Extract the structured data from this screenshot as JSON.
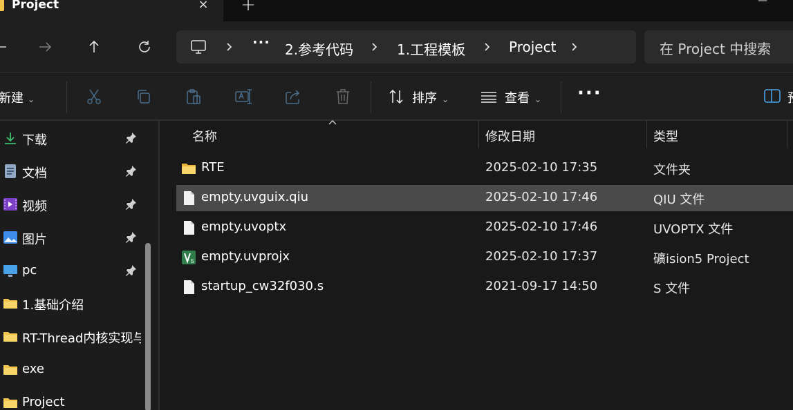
{
  "tab": {
    "title": "Project",
    "close": "×",
    "new": "+"
  },
  "nav": {
    "back": "←",
    "forward": "→",
    "up": "↑",
    "refresh": "↻",
    "more": "···",
    "breadcrumbs": [
      "2.参考代码",
      "1.工程模板",
      "Project"
    ],
    "search_placeholder": "在 Project 中搜索"
  },
  "toolbar": {
    "new_label": "新建",
    "sort_label": "排序",
    "view_label": "查看",
    "more": "···",
    "details_label": "预"
  },
  "sidebar": {
    "items": [
      {
        "label": "下载",
        "icon": "download-icon",
        "pinned": true
      },
      {
        "label": "文档",
        "icon": "document-icon",
        "pinned": true
      },
      {
        "label": "视频",
        "icon": "video-icon",
        "pinned": true
      },
      {
        "label": "图片",
        "icon": "picture-icon",
        "pinned": true
      },
      {
        "label": "pc",
        "icon": "monitor-icon",
        "pinned": true
      },
      {
        "label": "1.基础介绍",
        "icon": "folder-icon",
        "pinned": false
      },
      {
        "label": "RT-Thread内核实现与",
        "icon": "folder-icon",
        "pinned": false
      },
      {
        "label": "exe",
        "icon": "folder-icon",
        "pinned": false
      },
      {
        "label": "Project",
        "icon": "folder-icon",
        "pinned": false
      }
    ]
  },
  "columns": {
    "name": "名称",
    "date": "修改日期",
    "type": "类型"
  },
  "files": [
    {
      "name": "RTE",
      "date": "2025-02-10 17:35",
      "type": "文件夹",
      "icon": "folder-icon"
    },
    {
      "name": "empty.uvguix.qiu",
      "date": "2025-02-10 17:46",
      "type": "QIU 文件",
      "icon": "file-icon"
    },
    {
      "name": "empty.uvoptx",
      "date": "2025-02-10 17:46",
      "type": "UVOPTX 文件",
      "icon": "file-icon"
    },
    {
      "name": "empty.uvprojx",
      "date": "2025-02-10 17:37",
      "type": "礦ision5 Project",
      "icon": "keil-project-icon"
    },
    {
      "name": "startup_cw32f030.s",
      "date": "2021-09-17 14:50",
      "type": "S 文件",
      "icon": "file-icon"
    }
  ],
  "colors": {
    "accent_folder": "#f3c44c",
    "selected_row": "#4a4a4a",
    "background": "#191919"
  }
}
